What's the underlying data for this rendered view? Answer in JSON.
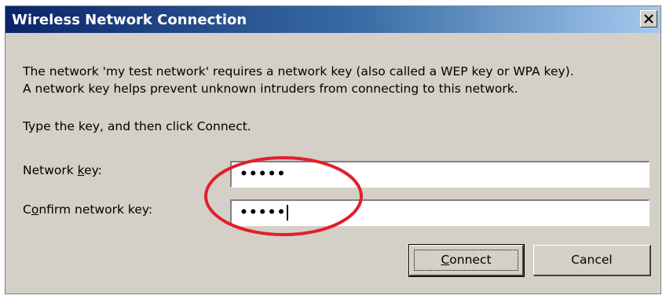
{
  "dialog": {
    "title": "Wireless Network Connection",
    "close_symbol": "×",
    "message_line1": "The network 'my test network' requires a network key (also called a WEP key or WPA key).",
    "message_line2": "A network key helps prevent unknown intruders from connecting to this network.",
    "instruction": "Type the key, and then click Connect.",
    "network_key": {
      "label_pre": "Network ",
      "label_mnemonic": "k",
      "label_post": "ey:",
      "value": "•••••"
    },
    "confirm_key": {
      "label_pre": "C",
      "label_mnemonic": "o",
      "label_post": "nfirm network key:",
      "value": "•••••"
    },
    "connect_button": {
      "mnemonic": "C",
      "rest": "onnect"
    },
    "cancel_button": "Cancel"
  },
  "colors": {
    "title_gradient_start": "#0a246a",
    "title_gradient_end": "#a6caf0",
    "dialog_bg": "#d4d0c8",
    "annotation_ellipse": "#e0202a"
  },
  "icons": {
    "close": "close-icon"
  }
}
